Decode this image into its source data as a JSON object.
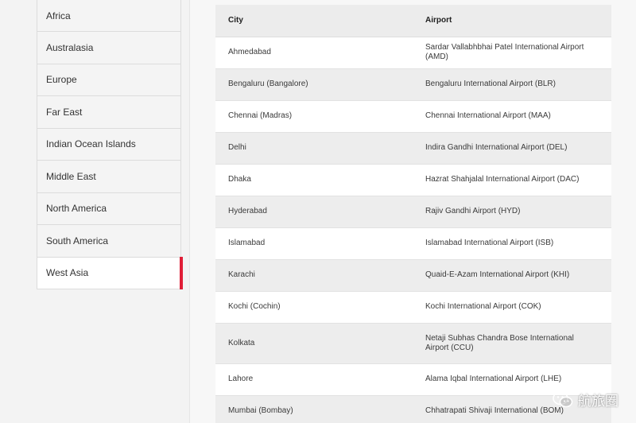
{
  "regions": [
    {
      "label": "Africa",
      "active": false
    },
    {
      "label": "Australasia",
      "active": false
    },
    {
      "label": "Europe",
      "active": false
    },
    {
      "label": "Far East",
      "active": false
    },
    {
      "label": "Indian Ocean Islands",
      "active": false
    },
    {
      "label": "Middle East",
      "active": false
    },
    {
      "label": "North America",
      "active": false
    },
    {
      "label": "South America",
      "active": false
    },
    {
      "label": "West Asia",
      "active": true
    }
  ],
  "table": {
    "headers": {
      "city": "City",
      "airport": "Airport"
    },
    "rows": [
      {
        "city": "Ahmedabad",
        "airport": "Sardar Vallabhbhai Patel International Airport (AMD)"
      },
      {
        "city": "Bengaluru (Bangalore)",
        "airport": "Bengaluru International Airport (BLR)"
      },
      {
        "city": "Chennai (Madras)",
        "airport": "Chennai International Airport (MAA)"
      },
      {
        "city": "Delhi",
        "airport": "Indira Gandhi International Airport (DEL)"
      },
      {
        "city": "Dhaka",
        "airport": "Hazrat Shahjalal International Airport (DAC)"
      },
      {
        "city": "Hyderabad",
        "airport": "Rajiv Gandhi Airport (HYD)"
      },
      {
        "city": "Islamabad",
        "airport": "Islamabad International Airport (ISB)"
      },
      {
        "city": "Karachi",
        "airport": "Quaid-E-Azam International Airport (KHI)"
      },
      {
        "city": "Kochi (Cochin)",
        "airport": "Kochi International Airport (COK)"
      },
      {
        "city": "Kolkata",
        "airport": "Netaji Subhas Chandra Bose International Airport (CCU)"
      },
      {
        "city": "Lahore",
        "airport": "Alama Iqbal International Airport (LHE)"
      },
      {
        "city": "Mumbai (Bombay)",
        "airport": "Chhatrapati Shivaji International (BOM)"
      }
    ]
  },
  "watermark": {
    "text": "航旅圈",
    "icon": "wechat-icon"
  },
  "colors": {
    "accent": "#e01e37",
    "row_alt": "#ededed",
    "row": "#ffffff"
  }
}
